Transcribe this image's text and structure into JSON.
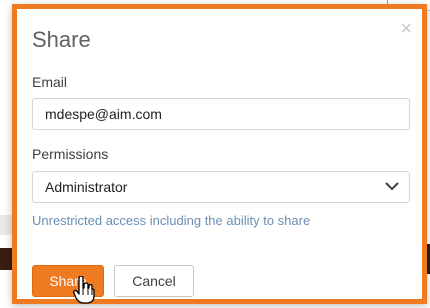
{
  "dialog": {
    "title": "Share",
    "close_icon": "close-icon",
    "email": {
      "label": "Email",
      "value": "mdespe@aim.com"
    },
    "permissions": {
      "label": "Permissions",
      "selected": "Administrator",
      "help_text": "Unrestricted access including the ability to share"
    },
    "buttons": {
      "share_label": "Share",
      "cancel_label": "Cancel"
    }
  },
  "colors": {
    "accent": "#f07a1f",
    "help_text": "#6b8fb3"
  },
  "cursor": "hand-pointer-icon"
}
